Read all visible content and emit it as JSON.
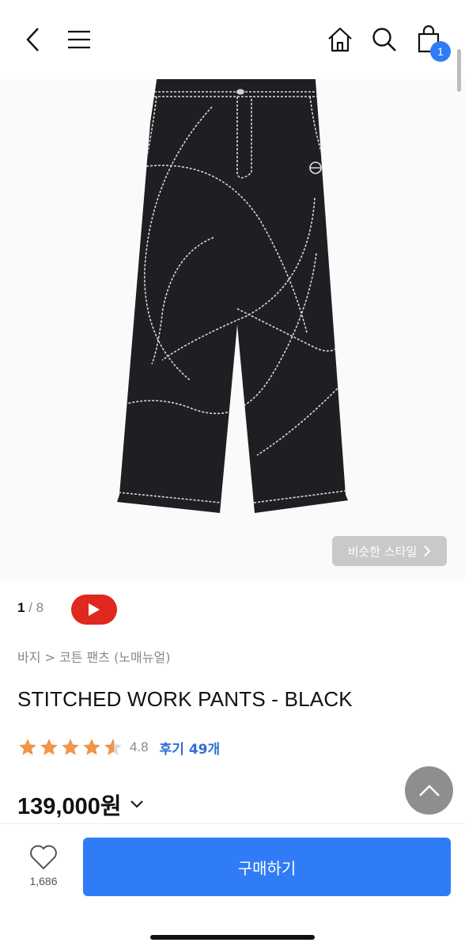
{
  "header": {
    "back_icon": "chevron-left-icon",
    "menu_icon": "hamburger-menu-icon",
    "home_icon": "home-icon",
    "search_icon": "search-icon",
    "cart_icon": "shopping-bag-icon",
    "cart_count": "1"
  },
  "gallery": {
    "current": "1",
    "separator": " / ",
    "total": "8",
    "similar_style_label": "비슷한 스타일",
    "similar_style_icon": "chevron-right-icon",
    "video_icon": "youtube-play-icon"
  },
  "product": {
    "breadcrumb": "바지 > 코튼 팬츠 (노매뉴얼)",
    "title": "STITCHED WORK PANTS - BLACK",
    "rating": 4.5,
    "rating_text": "4.8",
    "review_label": "후기 49개",
    "price": "139,000원",
    "price_toggle_icon": "chevron-down-icon"
  },
  "footer": {
    "like_icon": "heart-icon",
    "like_count": "1,686",
    "buy_label": "구매하기",
    "scroll_top_icon": "chevron-up-icon"
  },
  "colors": {
    "accent": "#2f7cf6",
    "star": "#f0954a",
    "youtube": "#e0281e",
    "link": "#2f6fd6"
  }
}
